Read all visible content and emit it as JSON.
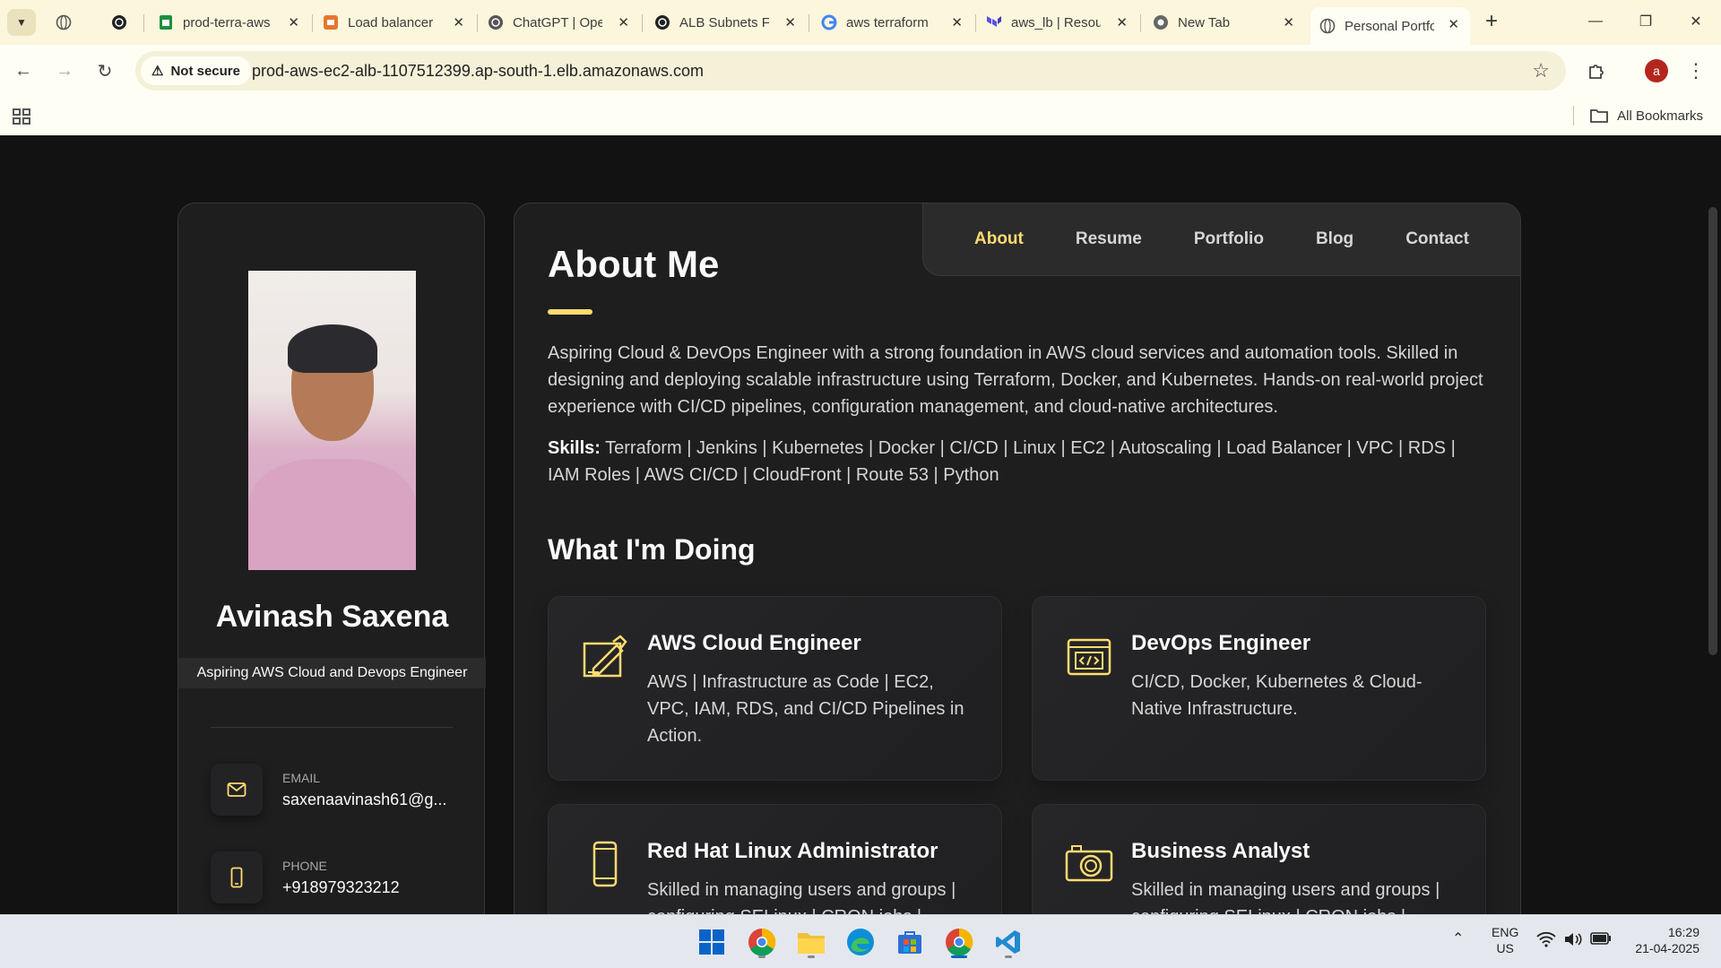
{
  "browser": {
    "tabs": [
      {
        "label": "",
        "icon": "globe-icon"
      },
      {
        "label": "",
        "icon": "openai-icon"
      },
      {
        "label": "prod-terra-aws",
        "icon": "sheets-icon"
      },
      {
        "label": "Load balancer",
        "icon": "aws-icon"
      },
      {
        "label": "ChatGPT | Ope",
        "icon": "openai-icon"
      },
      {
        "label": "ALB Subnets F",
        "icon": "openai-icon"
      },
      {
        "label": "aws terraform",
        "icon": "google-icon"
      },
      {
        "label": "aws_lb | Resou",
        "icon": "terraform-icon"
      },
      {
        "label": "New Tab",
        "icon": "chrome-icon"
      },
      {
        "label": "Personal Portfo",
        "icon": "globe-icon",
        "active": true
      }
    ],
    "security_label": "Not secure",
    "url": "prod-aws-ec2-alb-1107512399.ap-south-1.elb.amazonaws.com",
    "bookmarks_label": "All Bookmarks",
    "profile_initial": "a"
  },
  "sidebar": {
    "name": "Avinash Saxena",
    "title": "Aspiring AWS Cloud and Devops Engineer",
    "contacts": [
      {
        "label": "Email",
        "value": "saxenaavinash61@g...",
        "icon": "mail-icon"
      },
      {
        "label": "Phone",
        "value": "+918979323212",
        "icon": "phone-icon"
      }
    ]
  },
  "nav": {
    "items": [
      "About",
      "Resume",
      "Portfolio",
      "Blog",
      "Contact"
    ],
    "active": "About"
  },
  "about": {
    "heading": "About Me",
    "paragraph": "Aspiring Cloud & DevOps Engineer with a strong foundation in AWS cloud services and automation tools. Skilled in designing and deploying scalable infrastructure using Terraform, Docker, and Kubernetes. Hands-on real-world project experience with CI/CD pipelines, configuration management, and cloud-native architectures.",
    "skills_label": "Skills:",
    "skills": "Terraform | Jenkins | Kubernetes | Docker | CI/CD | Linux | EC2 | Autoscaling | Load Balancer | VPC | RDS | IAM Roles | AWS CI/CD | CloudFront | Route 53 | Python",
    "services_heading": "What I'm Doing",
    "services": [
      {
        "title": "AWS Cloud Engineer",
        "desc": "AWS | Infrastructure as Code | EC2, VPC, IAM, RDS, and CI/CD Pipelines in Action.",
        "icon": "design-icon"
      },
      {
        "title": "DevOps Engineer",
        "desc": "CI/CD, Docker, Kubernetes & Cloud-Native Infrastructure.",
        "icon": "code-window-icon"
      },
      {
        "title": "Red Hat Linux Administrator",
        "desc": "Skilled in managing users and groups | configuring SELinux | CRON jobs |",
        "icon": "mobile-icon"
      },
      {
        "title": "Business Analyst",
        "desc": "Skilled in managing users and groups | configuring SELinux | CRON jobs |",
        "icon": "camera-icon"
      }
    ]
  },
  "taskbar": {
    "lang_top": "ENG",
    "lang_bottom": "US",
    "time": "16:29",
    "date": "21-04-2025"
  },
  "colors": {
    "accent": "#ffdb70",
    "page_bg": "#121212",
    "card_bg": "#1e1e1f",
    "chrome_bg": "#fbf6dc"
  }
}
